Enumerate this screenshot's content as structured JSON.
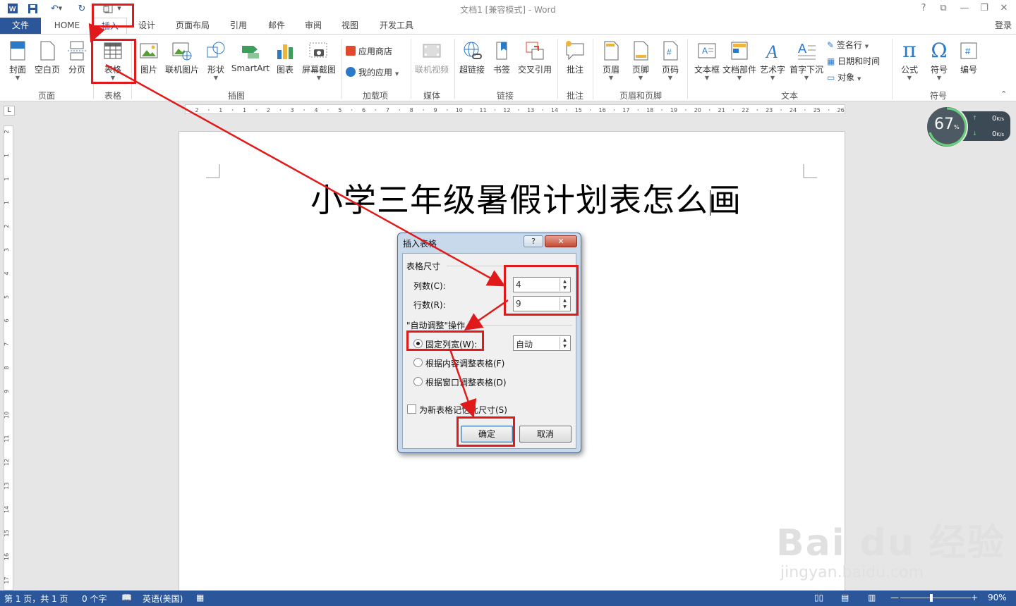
{
  "window": {
    "title": "文档1 [兼容模式] - Word",
    "help": "?",
    "login": "登录"
  },
  "tabs": [
    "文件",
    "HOME",
    "插入",
    "设计",
    "页面布局",
    "引用",
    "邮件",
    "审阅",
    "视图",
    "开发工具"
  ],
  "ribbon": {
    "buttons": {
      "cover": "封面",
      "blank": "空白页",
      "pagebreak": "分页",
      "table": "表格",
      "picture": "图片",
      "online_picture": "联机图片",
      "shapes": "形状",
      "smartart": "SmartArt",
      "chart": "图表",
      "screenshot": "屏幕截图",
      "app_store": "应用商店",
      "my_apps": "我的应用",
      "online_video": "联机视频",
      "hyperlink": "超链接",
      "bookmark": "书签",
      "cross_ref": "交叉引用",
      "comment": "批注",
      "header": "页眉",
      "footer": "页脚",
      "page_number": "页码",
      "textbox": "文本框",
      "quick_parts": "文档部件",
      "wordart": "艺术字",
      "dropcap": "首字下沉",
      "signature": "签名行",
      "datetime": "日期和时间",
      "object": "对象",
      "equation": "公式",
      "symbol": "符号",
      "numbering": "编号"
    },
    "groups": {
      "pages": "页面",
      "tables": "表格",
      "illustrations": "插图",
      "addins": "加载项",
      "media": "媒体",
      "links": "链接",
      "comments": "批注",
      "header_footer": "页眉和页脚",
      "text": "文本",
      "symbols": "符号"
    }
  },
  "ruler": {
    "h_ticks": [
      "2",
      "1",
      "1",
      "2",
      "3",
      "4",
      "5",
      "6",
      "7",
      "8",
      "9",
      "10",
      "11",
      "12",
      "13",
      "14",
      "15",
      "16",
      "17",
      "18",
      "19",
      "20",
      "21",
      "22",
      "23",
      "24",
      "25",
      "26"
    ],
    "v_ticks": [
      "2",
      "1",
      "1",
      "1",
      "2",
      "3",
      "4",
      "5",
      "6",
      "7",
      "8",
      "9",
      "10",
      "11",
      "12",
      "13",
      "14",
      "15",
      "16",
      "17"
    ]
  },
  "document": {
    "heading": "小学三年级暑假计划表怎么画"
  },
  "net_monitor": {
    "percent": "67",
    "percent_unit": "%",
    "up": "0",
    "down": "0",
    "unit": "K/s"
  },
  "dialog": {
    "title": "插入表格",
    "help": "?",
    "close": "✕",
    "size_group": "表格尺寸",
    "columns_label": "列数(C):",
    "columns_value": "4",
    "rows_label": "行数(R):",
    "rows_value": "9",
    "autofit_group": "\"自动调整\"操作",
    "fixed_width_label": "固定列宽(W):",
    "fixed_width_value": "自动",
    "autofit_contents_label": "根据内容调整表格(F)",
    "autofit_window_label": "根据窗口调整表格(D)",
    "remember_label": "为新表格记忆此尺寸(S)",
    "ok_label": "确定",
    "cancel_label": "取消"
  },
  "status": {
    "page": "第 1 页，共 1 页",
    "words": "0 个字",
    "language": "英语(美国)",
    "zoom": "90%",
    "zoom_level": 0.9
  },
  "watermark": {
    "brand": "Bai du 经验",
    "url": "jingyan.baidu.com"
  },
  "colors": {
    "accent": "#2b579a",
    "annotation_red": "#e01a1a"
  }
}
